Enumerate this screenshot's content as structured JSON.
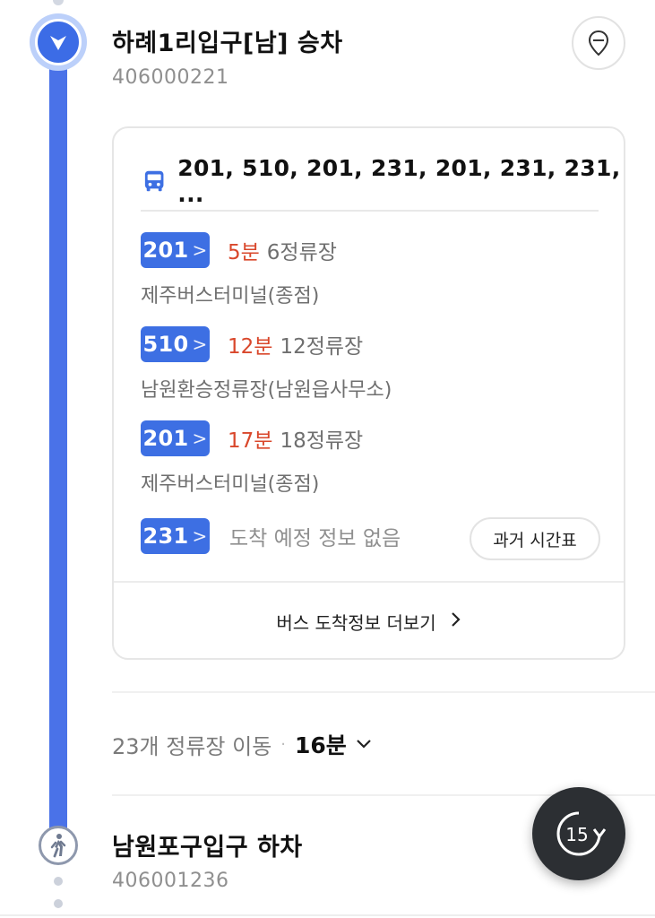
{
  "boarding": {
    "title": "하례1리입구[남] 승차",
    "stop_id": "406000221"
  },
  "bus_card": {
    "routes_summary": "201, 510, 201, 231, 201, 231, 231, ...",
    "arrivals": [
      {
        "route": "201",
        "eta": "5분",
        "stops": "6정류장",
        "direction": "제주버스터미널(종점)"
      },
      {
        "route": "510",
        "eta": "12분",
        "stops": "12정류장",
        "direction": "남원환승정류장(남원읍사무소)"
      },
      {
        "route": "201",
        "eta": "17분",
        "stops": "18정류장",
        "direction": "제주버스터미널(종점)"
      },
      {
        "route": "231",
        "status": "도착 예정 정보 없음"
      }
    ],
    "timetable_button": "과거 시간표",
    "more_label": "버스 도착정보 더보기"
  },
  "segment": {
    "stops_moved": "23개 정류장 이동",
    "duration": "16분"
  },
  "alighting": {
    "title": "남원포구입구 하차",
    "stop_id": "406001236"
  },
  "fab": {
    "label": "15"
  },
  "colors": {
    "route_line": "#4a72e8",
    "badge": "#3d6fe3",
    "eta": "#d9472b"
  },
  "icons": {
    "start": "chevron-down-icon",
    "pin": "location-pin-icon",
    "bus": "bus-icon",
    "walk": "walking-person-icon",
    "fab": "replay-15-icon"
  }
}
